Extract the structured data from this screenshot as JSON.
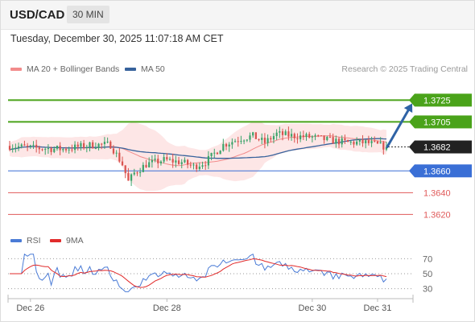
{
  "header": {
    "pair": "USD/CAD",
    "timeframe": "30 MIN"
  },
  "datetime": "Tuesday, December 30, 2025 11:07:18 AM CET",
  "legend": {
    "ma20_label": "MA 20 + Bollinger Bands",
    "ma50_label": "MA 50",
    "rsi_label": "RSI",
    "rsi_ma_label": "9MA"
  },
  "credit": "Research © 2025 Trading Central",
  "colors": {
    "up": "#3ba36a",
    "down": "#d9534f",
    "ma50": "#37629c",
    "bollinger_fill": "#fde6e6",
    "ma20": "#f28b8b",
    "resistance": "#4aa31a",
    "pivot": "#3a6fd6",
    "support": "#e05a5a",
    "last": "#222222",
    "arrow": "#2f63a6",
    "rsi": "#4a7bd6",
    "rsi_ma": "#e12b2b"
  },
  "chart_data": [
    {
      "type": "candlestick",
      "title": "USD/CAD",
      "ylim": [
        1.3604,
        1.3746
      ],
      "levels": [
        {
          "label": "1.3725",
          "value": 1.3725,
          "kind": "resistance"
        },
        {
          "label": "1.3705",
          "value": 1.3705,
          "kind": "resistance"
        },
        {
          "label": "1.3682",
          "value": 1.3682,
          "kind": "last"
        },
        {
          "label": "1.3660",
          "value": 1.366,
          "kind": "pivot"
        },
        {
          "label": "1.3640",
          "value": 1.364,
          "kind": "support"
        },
        {
          "label": "1.3620",
          "value": 1.362,
          "kind": "support"
        }
      ],
      "x_labels": [
        {
          "label": "Dec 26",
          "index": 7
        },
        {
          "label": "Dec 28",
          "index": 53
        },
        {
          "label": "Dec 30",
          "index": 102
        },
        {
          "label": "Dec 31",
          "index": 124
        }
      ],
      "target": 1.3722
    },
    {
      "type": "line",
      "title": "RSI",
      "ylim": [
        20,
        80
      ],
      "y_ticks": [
        "70",
        "50",
        "30"
      ],
      "series": [
        {
          "name": "RSI"
        },
        {
          "name": "9MA"
        }
      ]
    }
  ]
}
